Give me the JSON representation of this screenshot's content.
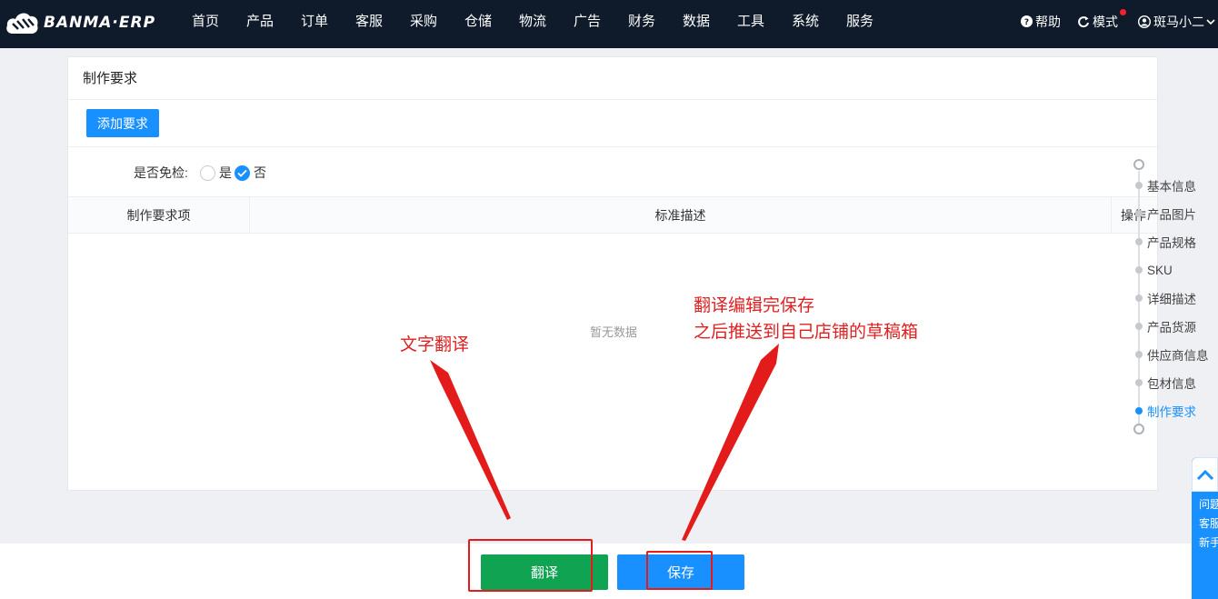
{
  "app": {
    "logo_text": "BANMA·ERP",
    "nav_items": [
      "首页",
      "产品",
      "订单",
      "客服",
      "采购",
      "仓储",
      "物流",
      "广告",
      "财务",
      "数据",
      "工具",
      "系统",
      "服务"
    ],
    "help_label": "帮助",
    "mode_label": "模式",
    "user_label": "斑马小二"
  },
  "card": {
    "title": "制作要求",
    "add_button": "添加要求",
    "inspection_label": "是否免检:",
    "option_yes": "是",
    "option_no": "否",
    "selected_option": "否",
    "columns": [
      "制作要求项",
      "标准描述",
      "操作"
    ],
    "empty_text": "暂无数据"
  },
  "step_nav": {
    "items": [
      "基本信息",
      "产品图片",
      "产品规格",
      "SKU",
      "详细描述",
      "产品货源",
      "供应商信息",
      "包材信息",
      "制作要求"
    ],
    "active": "制作要求"
  },
  "actions": {
    "translate_button": "翻译",
    "save_button": "保存"
  },
  "annotations": {
    "translate_note": "文字翻译",
    "save_note_line1": "翻译编辑完保存",
    "save_note_line2": "之后推送到自己店铺的草稿箱"
  },
  "feedback_widget": {
    "items": [
      "问题建议",
      "客服咨询",
      "新手必看"
    ]
  },
  "colors": {
    "topbar": "#0f1a2b",
    "primary": "#1890ff",
    "translate_green": "#0fa352",
    "annotation_red": "#e02020"
  }
}
